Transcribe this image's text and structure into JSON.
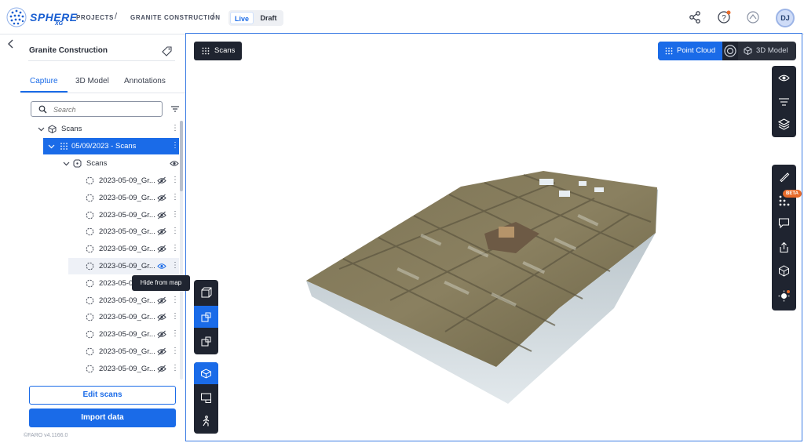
{
  "brand": {
    "name": "SPHERE",
    "sub": "XG"
  },
  "breadcrumb": {
    "projects": "PROJECTS",
    "sep": "/",
    "project": "GRANITE CONSTRUCTION"
  },
  "mode_switch": {
    "live": "Live",
    "draft": "Draft"
  },
  "user": {
    "initials": "DJ"
  },
  "sidebar": {
    "title": "Granite Construction",
    "tabs": [
      "Capture",
      "3D Model",
      "Annotations"
    ],
    "active_tab": "Capture",
    "search_placeholder": "Search",
    "tree": {
      "root": "Scans",
      "group": "05/09/2023 - Scans",
      "sub": "Scans",
      "items": [
        "2023-05-09_Gr...",
        "2023-05-09_Gr...",
        "2023-05-09_Gr...",
        "2023-05-09_Gr...",
        "2023-05-09_Gr...",
        "2023-05-09_Gr...",
        "2023-05-0",
        "2023-05-09_Gr...",
        "2023-05-09_Gr...",
        "2023-05-09_Gr...",
        "2023-05-09_Gr...",
        "2023-05-09_Gr..."
      ]
    },
    "edit_button": "Edit scans",
    "import_button": "Import data",
    "version": "©FARO v4.1166.0"
  },
  "viewport": {
    "scans_label": "Scans",
    "tooltip": "Hide from map",
    "view_toggle": {
      "point_cloud": "Point Cloud",
      "model": "3D Model"
    },
    "beta_badge": "BETA"
  },
  "colors": {
    "accent": "#1a6be8",
    "dark": "#1f2430",
    "badge": "#e86b2a"
  }
}
